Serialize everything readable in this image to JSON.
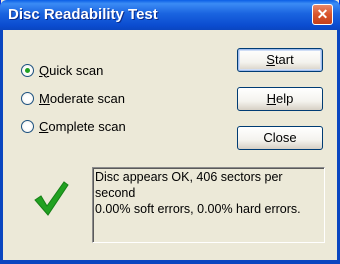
{
  "window": {
    "title": "Disc Readability Test",
    "close_glyph": "✕"
  },
  "scan_options": [
    {
      "label": "Quick scan",
      "mnemonic": "Q",
      "rest": "uick scan",
      "checked": true
    },
    {
      "label": "Moderate scan",
      "mnemonic": "M",
      "rest": "oderate scan",
      "checked": false
    },
    {
      "label": "Complete scan",
      "mnemonic": "C",
      "rest": "omplete scan",
      "checked": false
    }
  ],
  "buttons": {
    "start": {
      "label": "Start",
      "mnemonic": "S",
      "rest": "tart"
    },
    "help": {
      "label": "Help",
      "mnemonic": "H",
      "rest": "elp"
    },
    "close": {
      "label": "Close"
    }
  },
  "status": {
    "icon": "checkmark-icon",
    "line1": "Disc appears OK, 406 sectors per second",
    "line2": "0.00% soft errors, 0.00% hard errors."
  },
  "colors": {
    "title_bar": "#0a5ee6",
    "check": "#21a121",
    "close_button": "#d9542c"
  }
}
